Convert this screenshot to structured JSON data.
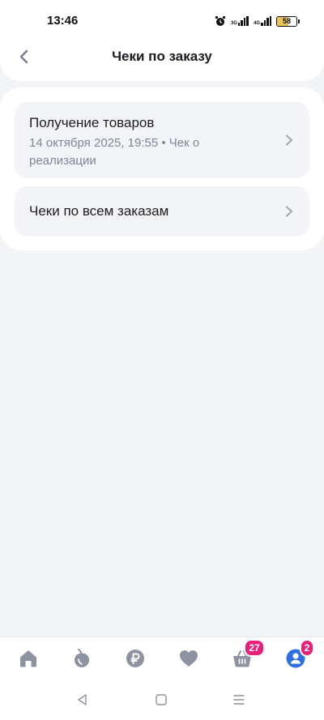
{
  "status_bar": {
    "time": "13:46",
    "net1": "3G",
    "net2": "4G",
    "battery": "58",
    "battery_level": 0.58
  },
  "header": {
    "title": "Чеки по заказу",
    "back_icon": "chevron-left-icon"
  },
  "list": {
    "items": [
      {
        "title": "Получение товаров",
        "subtitle": "14 октября 2025, 19:55 • Чек о реализации",
        "icon": "chevron-right-icon"
      },
      {
        "title": "Чеки по всем заказам",
        "icon": "chevron-right-icon"
      }
    ]
  },
  "bottom_nav": {
    "items": [
      {
        "name": "home",
        "icon": "home-icon"
      },
      {
        "name": "catalog",
        "icon": "fruit-icon"
      },
      {
        "name": "ruble",
        "icon": "ruble-icon"
      },
      {
        "name": "favorites",
        "icon": "heart-icon"
      },
      {
        "name": "cart",
        "icon": "basket-icon",
        "badge": "27"
      },
      {
        "name": "profile",
        "icon": "user-icon",
        "badge": "2",
        "active": true
      }
    ]
  },
  "colors": {
    "accent": "#2f6fe4",
    "badge": "#e8207a",
    "inactive_icon": "#8d93a0",
    "background": "#f3f4f8"
  }
}
